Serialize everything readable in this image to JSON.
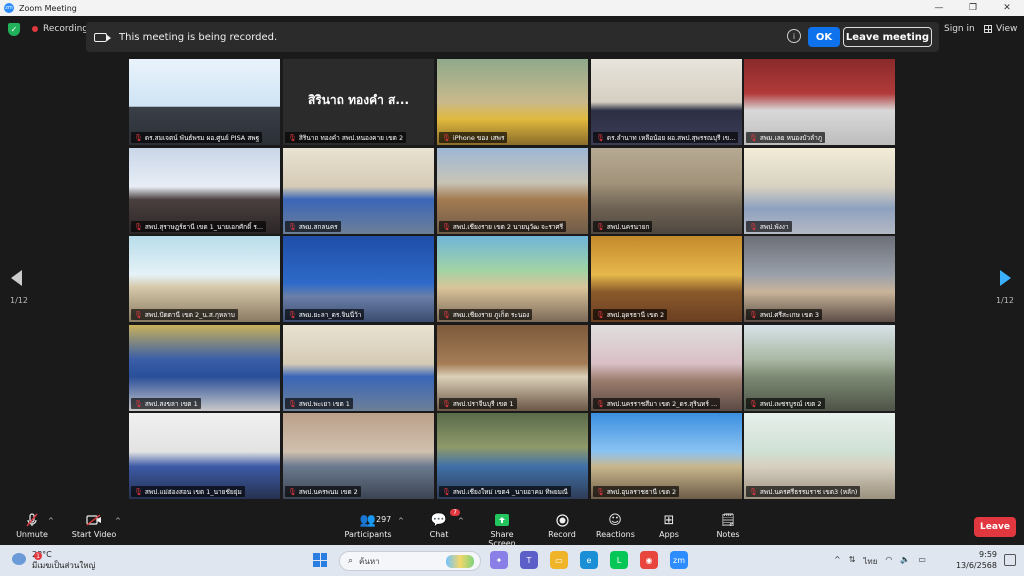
{
  "window": {
    "title": "Zoom Meeting",
    "min_icon": "minimize-icon",
    "max_icon": "maximize-icon",
    "close_icon": "close-icon"
  },
  "topbar": {
    "recording_label": "Recording",
    "signin_label": "Sign in",
    "view_label": "View"
  },
  "banner": {
    "text": "This meeting is being recorded.",
    "ok_label": "OK",
    "leave_label": "Leave meeting"
  },
  "pager": {
    "left": "1/12",
    "right": "1/12"
  },
  "tiles": [
    {
      "name": "ดร.สมเจตน์ พันธ์พรม ผอ.ศูนย์ PISA สพฐ",
      "scene": "presenter",
      "active": true
    },
    {
      "name": "สิรินาถ ทองคำ สพป.หนองคาย เขต 2",
      "scene": "name",
      "big": "สิรินาถ  ทองคำ ส..."
    },
    {
      "name": "iPhone ของ เสพร",
      "scene": "portrait"
    },
    {
      "name": "ดร.ลำนาท เหลือน้อย ผอ.สพป.สุพรรณบุรี เข...",
      "scene": "office"
    },
    {
      "name": "สพม.เลย หนองบัวลำภู",
      "scene": "ssrv"
    },
    {
      "name": "สพป.สุราษฎร์ธานี เขต 1_นายเอกศักดิ์ ร...",
      "scene": "woman"
    },
    {
      "name": "สพม.สกลนคร",
      "scene": "meeting"
    },
    {
      "name": "สพป.เชียงราย เขต 2 นายนุวัฒ จะราศรี",
      "scene": "hall"
    },
    {
      "name": "สพป.นครนายก",
      "scene": "conf"
    },
    {
      "name": "สพป.พังงา",
      "scene": "longtable"
    },
    {
      "name": "สพป.ปัตตานี เขต 2_น.ส.กุหลาบ",
      "scene": "office2"
    },
    {
      "name": "สพม.ยะลา_ดร.จินนี่ว้า",
      "scene": "blue"
    },
    {
      "name": "สพม.เชียงราย ภูเก็ต ระนอง",
      "scene": "poster"
    },
    {
      "name": "สพป.อุดรธานี เขต 2",
      "scene": "golden"
    },
    {
      "name": "สพป.ศรีสะเกษ เขต 3",
      "scene": "room"
    },
    {
      "name": "สพป.สงขลา เขต 1",
      "scene": "stage"
    },
    {
      "name": "สพป.พะเยา เขต 1",
      "scene": "meeting"
    },
    {
      "name": "สพป.ปราจีนบุรี เขต 1",
      "scene": "wood"
    },
    {
      "name": "สพป.นครราชสีมา เขต 2_ดร.สุรินทร์ ...",
      "scene": "pink"
    },
    {
      "name": "สพป.เพชรบูรณ์ เขต 2",
      "scene": "windows"
    },
    {
      "name": "สพป.แม่ฮ่องสอน เขต 1_นายชัยยุ่ม",
      "scene": "classroom"
    },
    {
      "name": "สพป.นครพนม เขต 2",
      "scene": "room2"
    },
    {
      "name": "สพป.เชียงใหม่ เขต4 _นายอาคม ทิพยมณี",
      "scene": "cave"
    },
    {
      "name": "สพป.อุบลราชธานี เขต 2",
      "scene": "sky"
    },
    {
      "name": "สพป.นครศรีธรรมราช เขต3 (หลัก)",
      "scene": "bright"
    }
  ],
  "toolbar": {
    "unmute": "Unmute",
    "start_video": "Start Video",
    "participants": "Participants",
    "participant_count": "297",
    "chat": "Chat",
    "chat_badge": "7",
    "share": "Share Screen",
    "record": "Record",
    "reactions": "Reactions",
    "apps": "Apps",
    "notes": "Notes",
    "leave": "Leave"
  },
  "taskbar": {
    "temp": "28°C",
    "weather_desc": "มีเมฆเป็นส่วนใหญ่",
    "weather_badge": "1",
    "search_placeholder": "ค้นหา",
    "lang": "ไทย",
    "time": "9:59",
    "date": "13/6/2568"
  }
}
